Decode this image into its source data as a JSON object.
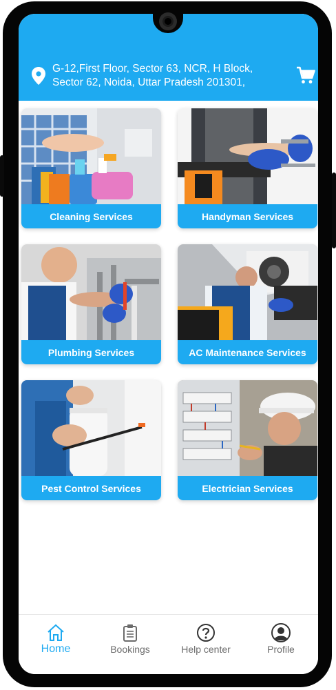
{
  "header": {
    "address": "G-12,First Floor, Sector 63, NCR, H Block, Sector 62, Noida, Uttar Pradesh 201301,"
  },
  "services": [
    {
      "label": "Cleaning Services",
      "icon": "cleaning-supplies"
    },
    {
      "label": "Handyman Services",
      "icon": "handyman-tools"
    },
    {
      "label": "Plumbing Services",
      "icon": "plumbing-wrench"
    },
    {
      "label": "AC Maintenance Services",
      "icon": "ac-unit"
    },
    {
      "label": "Pest Control Services",
      "icon": "sprayer"
    },
    {
      "label": "Electrician Services",
      "icon": "electric-panel"
    }
  ],
  "nav": {
    "home": "Home",
    "bookings": "Bookings",
    "help": "Help center",
    "profile": "Profile"
  },
  "colors": {
    "accent": "#1eaaf1",
    "nav_inactive": "#6b6b6b"
  }
}
